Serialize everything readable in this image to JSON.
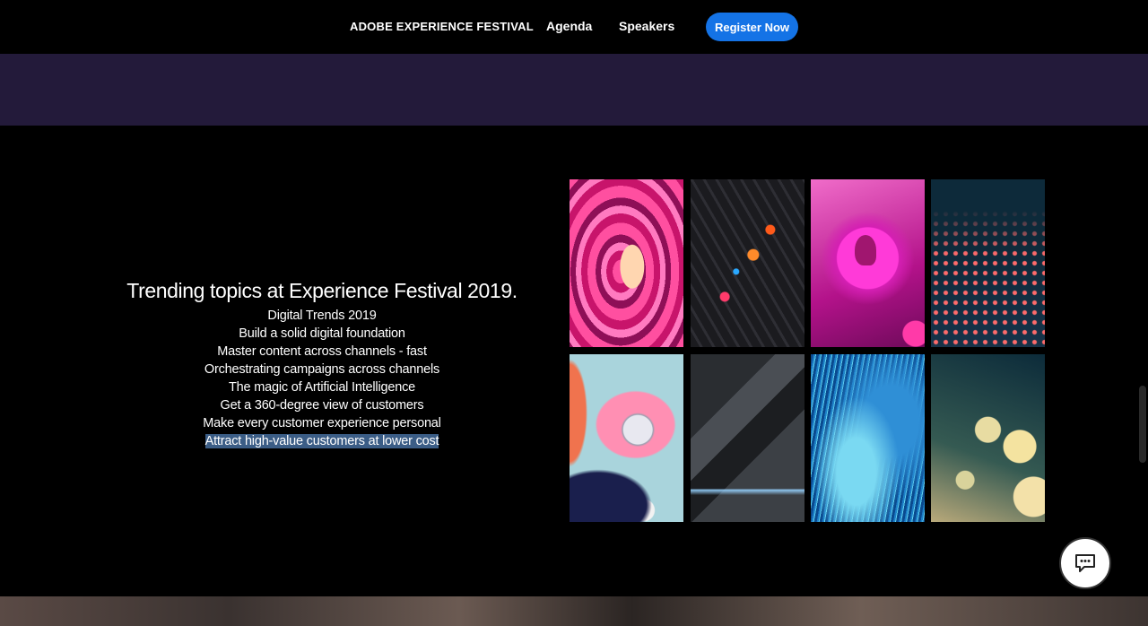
{
  "nav": {
    "brand": "ADOBE EXPERIENCE FESTIVAL",
    "links": [
      "Agenda",
      "Speakers"
    ],
    "cta": "Register Now",
    "cta_color": "#1473e6"
  },
  "topics": {
    "heading": "Trending topics at Experience Festival 2019.",
    "items": [
      "Digital Trends 2019",
      "Build a solid digital foundation",
      "Master content across channels - fast",
      "Orchestrating campaigns across channels",
      "The magic of Artificial Intelligence",
      "Get a 360-degree view of customers",
      "Make every customer experience personal",
      "Attract high-value customers at lower cost"
    ],
    "highlighted_index": 7
  },
  "gallery": {
    "tiles": [
      "pink-topography-art",
      "dark-hexagon-art",
      "pink-silhouette-orb-art",
      "teal-dotted-wave-art",
      "pastel-3d-shapes-art",
      "dark-geometric-light-art",
      "blue-particle-terrain-art",
      "golden-bokeh-network-art"
    ]
  },
  "chat": {
    "icon": "chat-bubble-icon"
  },
  "colors": {
    "purple_band": "#231a3a",
    "highlight": "#3b5d86"
  }
}
